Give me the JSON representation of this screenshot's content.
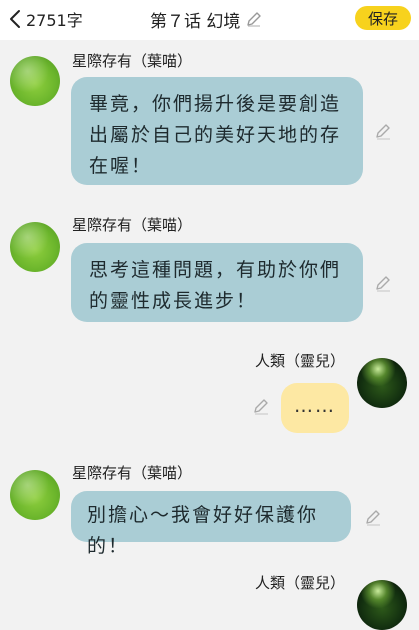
{
  "header": {
    "char_count": "2751字",
    "title": "第７话 幻境",
    "save_label": "保存"
  },
  "messages": [
    {
      "speaker": "星際存有（葉喵）",
      "text": "畢竟，你們揚升後是要創造出屬於自己的美好天地的存在喔！"
    },
    {
      "speaker": "星際存有（葉喵）",
      "text": "思考這種問題，有助於你們的靈性成長進步！"
    },
    {
      "speaker": "人類（靈兒）",
      "text": "……"
    },
    {
      "speaker": "星際存有（葉喵）",
      "text": "別擔心～我會好好保護你的！"
    },
    {
      "speaker": "人類（靈兒）",
      "text": ""
    }
  ],
  "icons": {
    "back": "chevron-left-icon",
    "edit": "pencil-icon"
  }
}
